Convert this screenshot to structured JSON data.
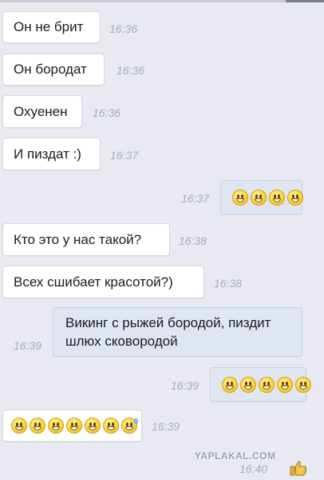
{
  "messages": [
    {
      "text": "Он не брит",
      "time": "16:36",
      "direction": "in"
    },
    {
      "text": "Он бородат",
      "time": "16:36",
      "direction": "in"
    },
    {
      "text": "Охуенен",
      "time": "16:36",
      "direction": "in"
    },
    {
      "text": "И пиздат :)",
      "time": "16:37",
      "direction": "in"
    },
    {
      "emoji_count": 4,
      "emoji": "grinning-smiley-icon",
      "time": "16:37",
      "direction": "out"
    },
    {
      "text": "Кто это у нас такой?",
      "time": "16:38",
      "direction": "in"
    },
    {
      "text": "Всех сшибает красотой?)",
      "time": "16:38",
      "direction": "in"
    },
    {
      "text_lines": [
        "Викинг с рыжей бородой, пиздит",
        "шлюх сковородой"
      ],
      "time": "16:39",
      "direction": "out"
    },
    {
      "emoji_count": 5,
      "emoji": "grinning-smiley-icon",
      "time": "16:39",
      "direction": "out"
    },
    {
      "emoji_count": 7,
      "emoji": "grinning-smiley-icon",
      "last_emoji": "sweat-smile-icon",
      "time": "16:39",
      "direction": "in"
    },
    {
      "time": "16:40",
      "status_icon": "thumbs-up-icon",
      "direction": "out"
    }
  ],
  "watermark": "YAPLAKAL.COM",
  "colors": {
    "background": "#e8e9f1",
    "incoming_bubble": "#ffffff",
    "outgoing_bubble": "#dfe6f2",
    "timestamp": "#a9adb9",
    "text": "#1b1b1b"
  }
}
